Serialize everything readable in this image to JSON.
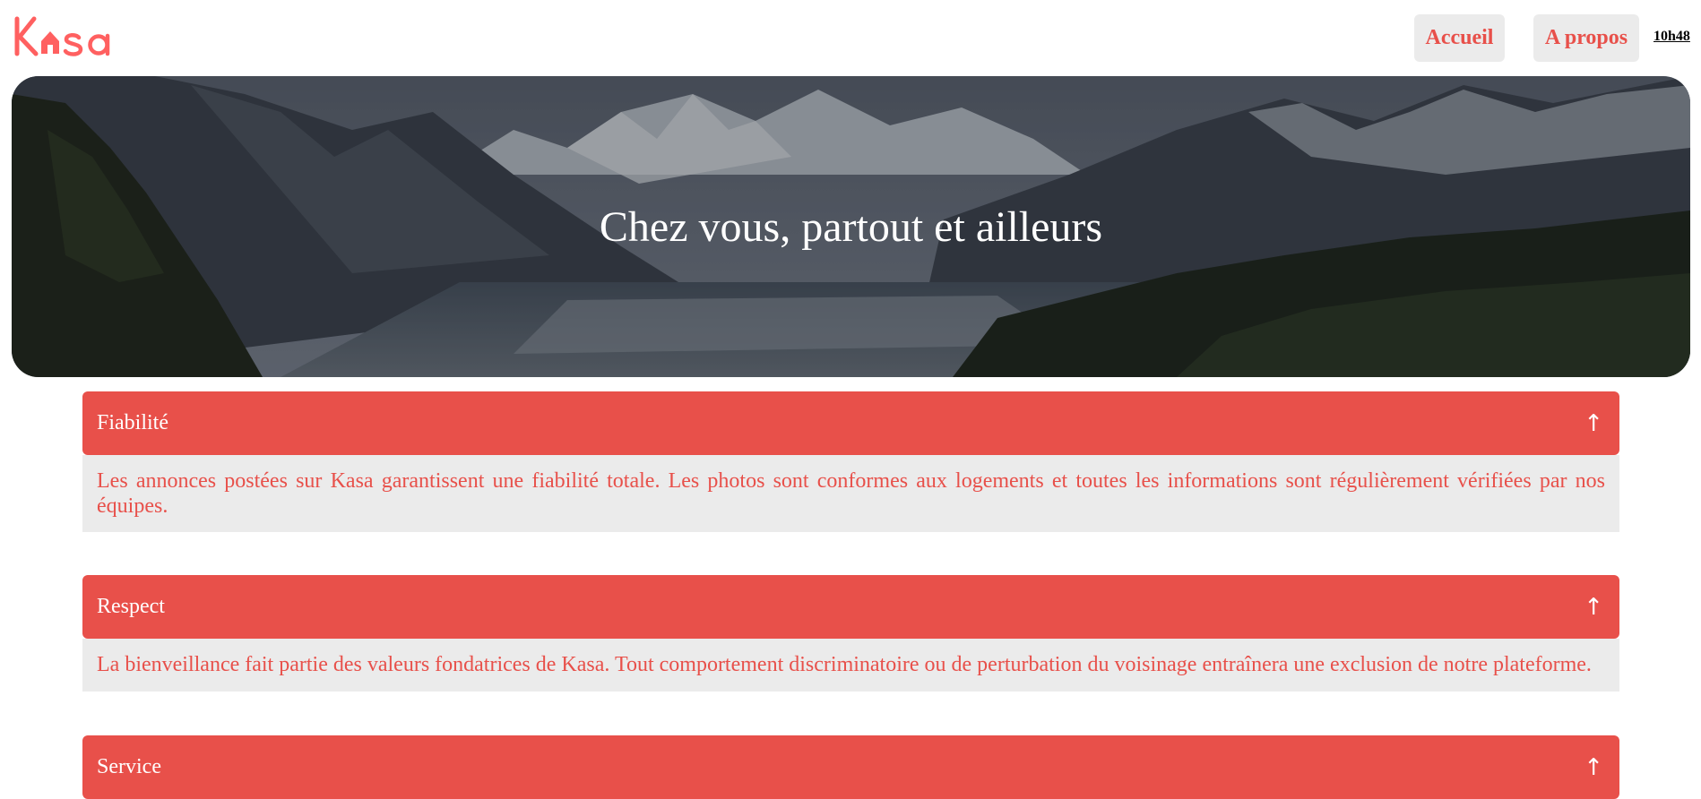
{
  "header": {
    "logo_text": "Kasa",
    "nav": [
      {
        "label": "Accueil"
      },
      {
        "label": "A propos"
      }
    ],
    "time": "10h48"
  },
  "banner": {
    "title": "Chez vous, partout et ailleurs"
  },
  "collapses": [
    {
      "title": "Fiabilité",
      "arrow": "↑",
      "content": "Les annonces postées sur Kasa garantissent une fiabilité totale. Les photos sont conformes aux logements et toutes les informations sont régulièrement vérifiées par nos équipes."
    },
    {
      "title": "Respect",
      "arrow": "↑",
      "content": "La bienveillance fait partie des valeurs fondatrices de Kasa. Tout comportement discriminatoire ou de perturbation du voisinage entraînera une exclusion de notre plateforme."
    },
    {
      "title": "Service",
      "arrow": "↑"
    }
  ],
  "colors": {
    "brand": "#ff6060",
    "accent": "#e8504a",
    "panel": "#ebebeb"
  }
}
